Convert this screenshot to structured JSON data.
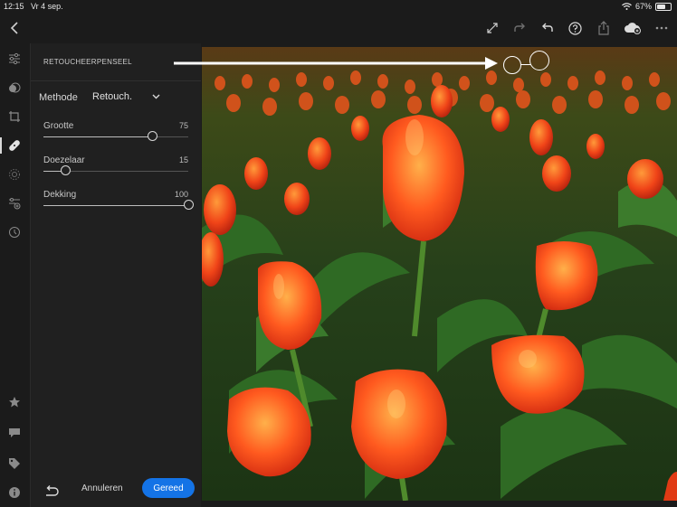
{
  "status": {
    "time": "12:15",
    "date": "Vr 4 sep.",
    "battery": "67%",
    "battery_level": 0.67
  },
  "toolbar": {
    "icons": [
      "back-chevron-icon",
      "fullscreen-icon",
      "redo-icon",
      "undo-icon",
      "help-icon",
      "share-icon",
      "cloud-sync-icon",
      "more-icon"
    ]
  },
  "rail": {
    "items": [
      "edit-sliders-icon",
      "presets-icon",
      "crop-icon",
      "healing-brush-icon",
      "selective-icon",
      "versions-icon",
      "history-icon",
      "rating-icon",
      "comments-icon",
      "keywords-icon",
      "info-icon"
    ],
    "active": "healing-brush-icon"
  },
  "panel": {
    "title": "RETOUCHEERPENSEEL",
    "method_label": "Methode",
    "method_value": "Retouch.",
    "sliders": [
      {
        "label": "Grootte",
        "value": "75",
        "fraction": 0.75
      },
      {
        "label": "Doezelaar",
        "value": "15",
        "fraction": 0.15
      },
      {
        "label": "Dekking",
        "value": "100",
        "fraction": 1.0
      }
    ],
    "cancel_label": "Annuleren",
    "done_label": "Gereed"
  },
  "colors": {
    "accent": "#1473e6",
    "panel_bg": "#202020",
    "app_bg": "#1b1b1b"
  }
}
